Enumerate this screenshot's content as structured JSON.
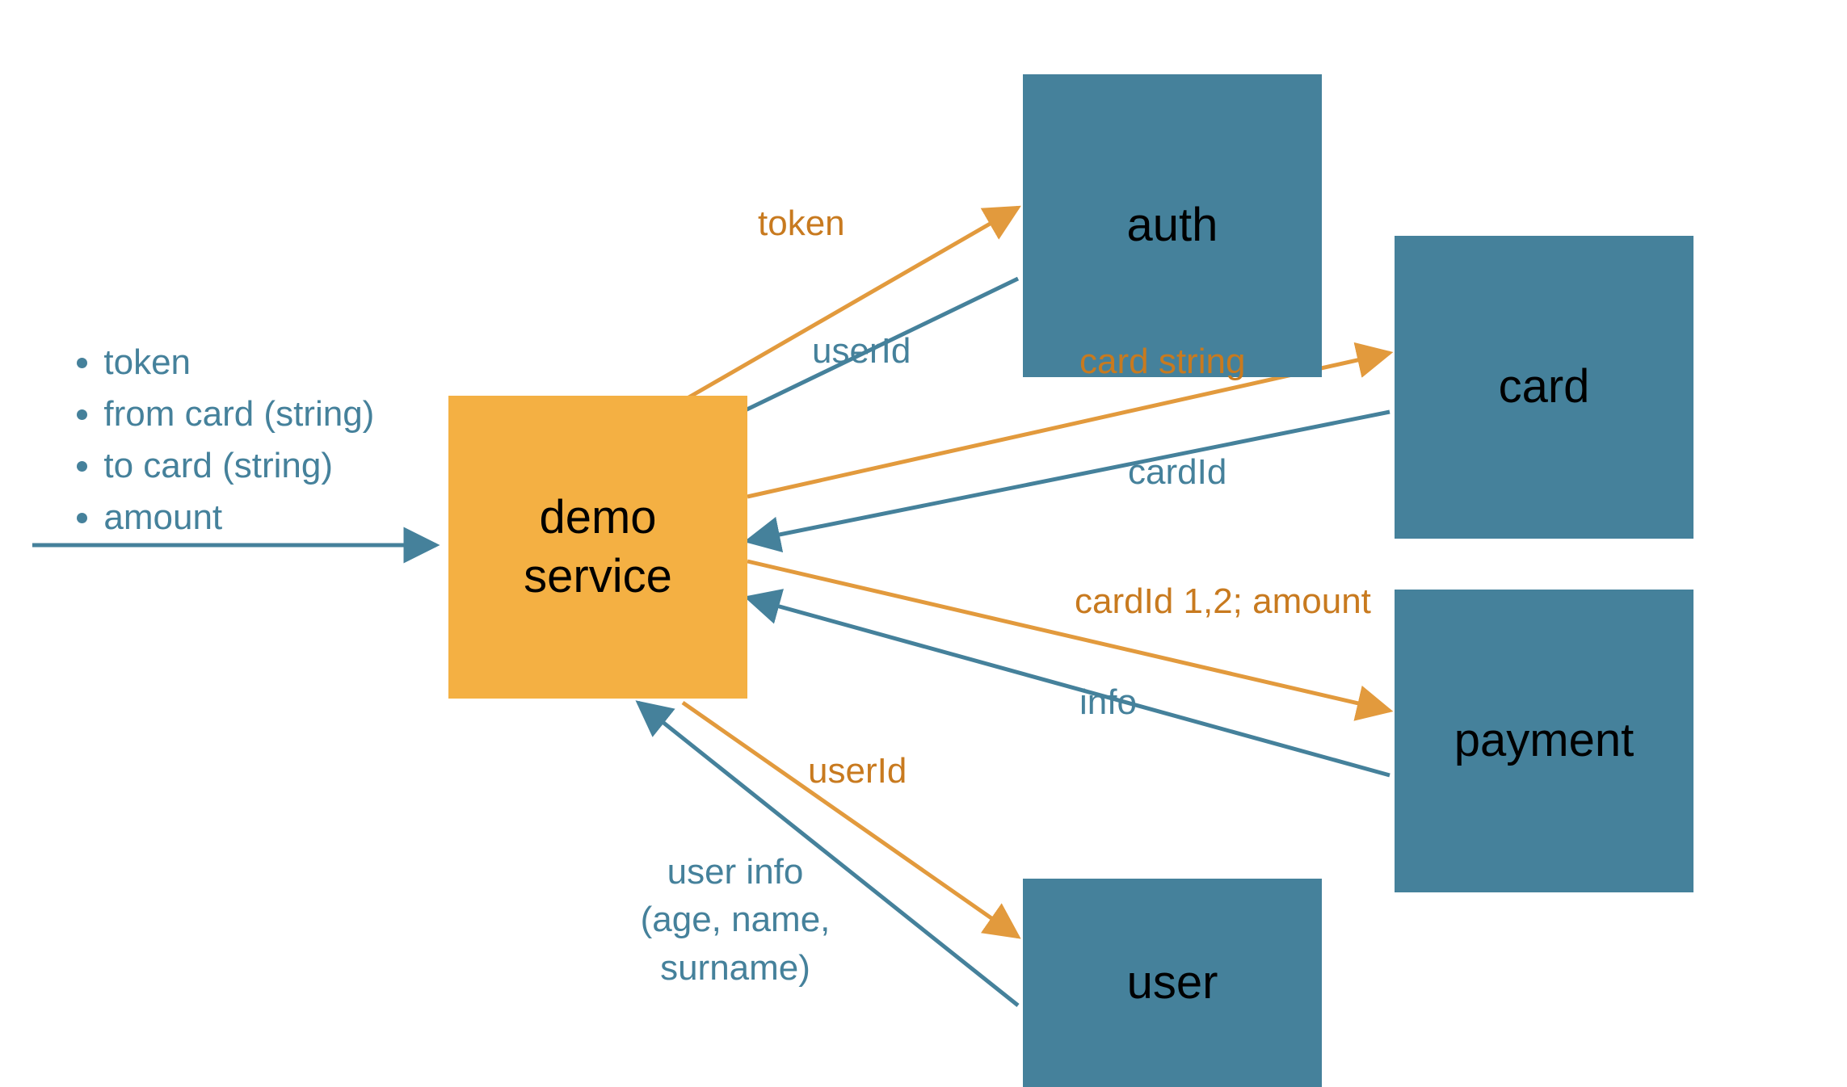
{
  "colors": {
    "teal": "#45819b",
    "orange_fill": "#f4b043",
    "orange_line": "#e29a3d",
    "orange_text": "#c87a1f"
  },
  "inputs": {
    "items": [
      "token",
      "from card (string)",
      "to card (string)",
      "amount"
    ]
  },
  "nodes": {
    "demo": {
      "label_line1": "demo",
      "label_line2": "service"
    },
    "auth": {
      "label": "auth"
    },
    "card": {
      "label": "card"
    },
    "payment": {
      "label": "payment"
    },
    "user": {
      "label": "user"
    }
  },
  "edges": {
    "auth_req": "token",
    "auth_res": "userId",
    "card_req": "card string",
    "card_res": "cardId",
    "payment_req": "cardId 1,2; amount",
    "payment_res": "info",
    "user_req": "userId",
    "user_res_line1": "user info",
    "user_res_line2": "(age, name,",
    "user_res_line3": "surname)"
  }
}
